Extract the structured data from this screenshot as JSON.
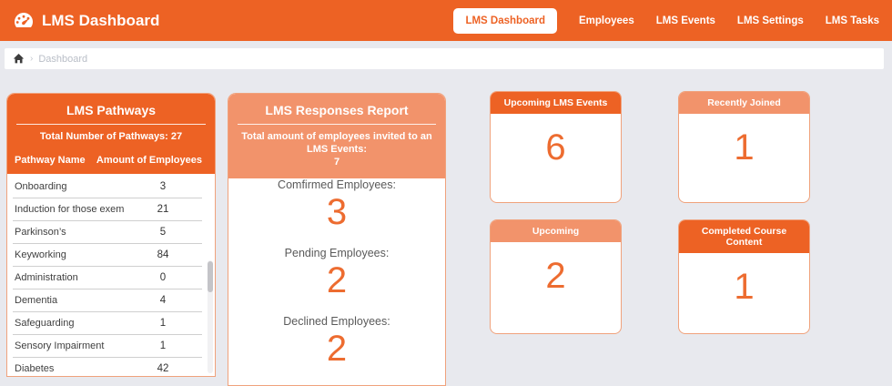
{
  "colors": {
    "accent": "#ED6224",
    "accent_light": "#F2936B",
    "number_orange": "#ED6C30",
    "background": "#E8E9EE"
  },
  "navbar": {
    "logo_icon": "gauge-icon",
    "title": "LMS Dashboard",
    "items": [
      {
        "label": "LMS Dashboard",
        "active": true
      },
      {
        "label": "Employees",
        "active": false
      },
      {
        "label": "LMS Events",
        "active": false
      },
      {
        "label": "LMS Settings",
        "active": false
      },
      {
        "label": "LMS Tasks",
        "active": false
      }
    ]
  },
  "breadcrumb": {
    "home_icon": "home-icon",
    "separator": "›",
    "current": "Dashboard"
  },
  "pathways": {
    "title": "LMS Pathways",
    "subtitle": "Total Number of Pathways: 27",
    "columns": {
      "name": "Pathway Name",
      "count": "Amount of Employees"
    },
    "rows": [
      {
        "name": "Onboarding",
        "count": "3"
      },
      {
        "name": "Induction for those exemp...",
        "count": "21"
      },
      {
        "name": "Parkinson’s",
        "count": "5"
      },
      {
        "name": "Keyworking",
        "count": "84"
      },
      {
        "name": "Administration",
        "count": "0"
      },
      {
        "name": "Dementia",
        "count": "4"
      },
      {
        "name": "Safeguarding",
        "count": "1"
      },
      {
        "name": "Sensory Impairment",
        "count": "1"
      },
      {
        "name": "Diabetes",
        "count": "42"
      }
    ]
  },
  "responses": {
    "title": "LMS Responses Report",
    "subtitle": "Total amount of employees invited to an LMS Events:",
    "total": "7",
    "stats": [
      {
        "label": "Comfirmed Employees:",
        "value": "3"
      },
      {
        "label": "Pending Employees:",
        "value": "2"
      },
      {
        "label": "Declined Employees:",
        "value": "2"
      }
    ]
  },
  "cards": [
    {
      "title": "Upcoming LMS Events",
      "value": "6",
      "variant": "dark"
    },
    {
      "title": "Recently Joined",
      "value": "1",
      "variant": "light"
    },
    {
      "title": "Upcoming",
      "value": "2",
      "variant": "light"
    },
    {
      "title": "Completed Course Content",
      "value": "1",
      "variant": "dark"
    }
  ]
}
